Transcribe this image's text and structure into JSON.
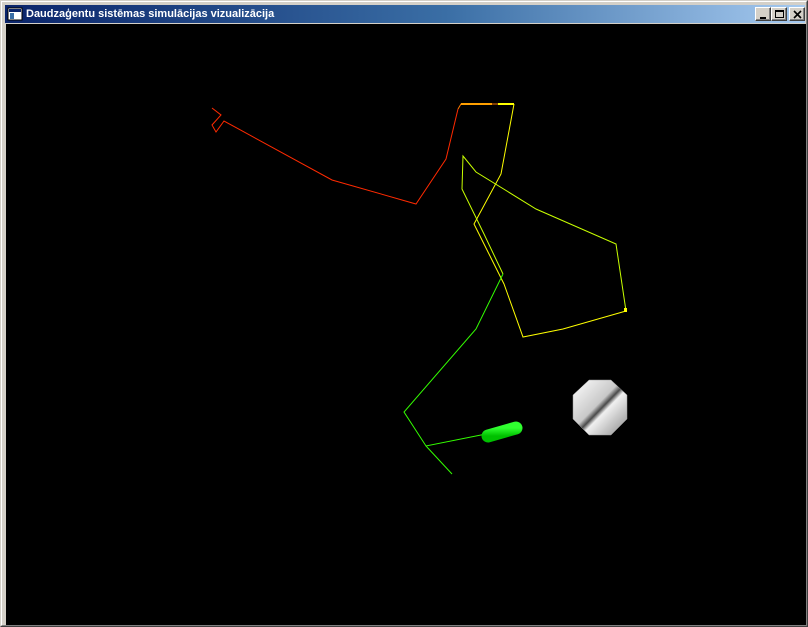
{
  "window": {
    "title": "Daudzaģentu sistēmas simulācijas vizualizācija"
  },
  "titlebar_buttons": {
    "minimize": "minimize-icon",
    "maximize": "maximize-icon",
    "close": "close-icon"
  },
  "scene": {
    "background_color": "#000000",
    "trail_colors": {
      "oldest": "#ff2a00",
      "orange": "#ff7a00",
      "yellow": "#ffff00",
      "yellow_green": "#c8ff00",
      "green": "#33ff00"
    },
    "agent_color": "#00e000",
    "obstacle_colors": [
      "#ffffff",
      "#b0b0b0",
      "#606060"
    ]
  }
}
